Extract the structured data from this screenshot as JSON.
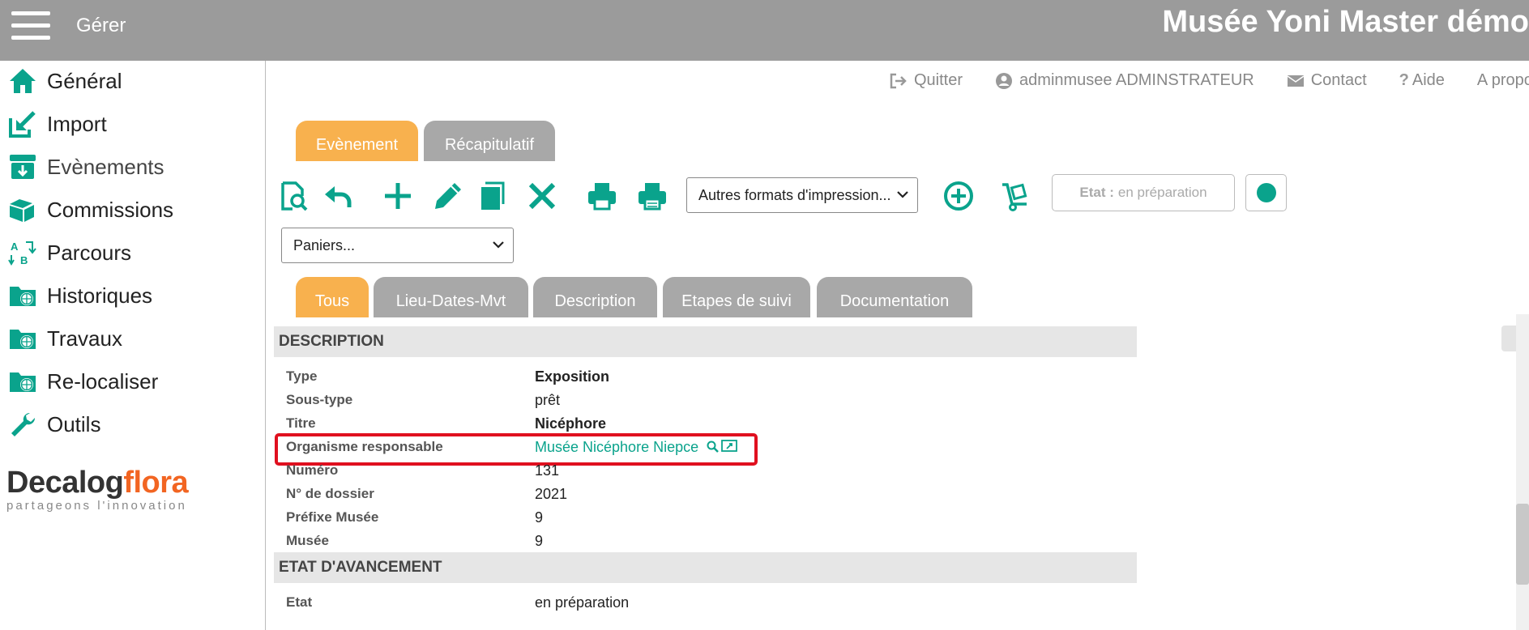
{
  "header": {
    "menu_label": "Gérer",
    "title": "Musée Yoni Master démo"
  },
  "sidebar": {
    "items": [
      {
        "label": "Général",
        "icon": "home-icon"
      },
      {
        "label": "Import",
        "icon": "import-icon"
      },
      {
        "label": "Evènements",
        "icon": "archive-box-icon"
      },
      {
        "label": "Commissions",
        "icon": "books-icon"
      },
      {
        "label": "Parcours",
        "icon": "sort-az-icon"
      },
      {
        "label": "Historiques",
        "icon": "folder-globe-icon"
      },
      {
        "label": "Travaux",
        "icon": "folder-globe-icon"
      },
      {
        "label": "Re-localiser",
        "icon": "folder-globe-icon"
      },
      {
        "label": "Outils",
        "icon": "wrench-icon"
      }
    ],
    "logo": {
      "brand_a": "Decalog",
      "brand_b": "flora",
      "tagline": "partageons l'innovation"
    }
  },
  "utility": {
    "quit": "Quitter",
    "user": "adminmusee ADMINSTRATEUR",
    "contact": "Contact",
    "help": "Aide",
    "about": "A propos"
  },
  "main_tabs": [
    "Evènement",
    "Récapitulatif"
  ],
  "toolbar": {
    "print_formats": "Autres formats d'impression...",
    "baskets": "Paniers...",
    "state_label": "Etat :",
    "state_value": "en préparation"
  },
  "sub_tabs": [
    "Tous",
    "Lieu-Dates-Mvt",
    "Description",
    "Etapes de suivi",
    "Documentation"
  ],
  "sections": {
    "description": {
      "title": "DESCRIPTION",
      "fields": [
        {
          "label": "Type",
          "value": "Exposition"
        },
        {
          "label": "Sous-type",
          "value": "prêt"
        },
        {
          "label": "Titre",
          "value": "Nicéphore"
        },
        {
          "label": "Organisme responsable",
          "value": "Musée Nicéphore Niepce"
        },
        {
          "label": "Numéro",
          "value": "131"
        },
        {
          "label": "N° de dossier",
          "value": "2021"
        },
        {
          "label": "Préfixe Musée",
          "value": "9"
        },
        {
          "label": "Musée",
          "value": "9"
        }
      ]
    },
    "progress": {
      "title": "ETAT D'AVANCEMENT",
      "fields": [
        {
          "label": "Etat",
          "value": "en préparation"
        }
      ]
    }
  },
  "colors": {
    "accent": "#0aa38c",
    "tab_active": "#f8b14e",
    "tab_inactive": "#a8a8a8",
    "topbar": "#9b9b9b",
    "highlight": "#e0101f"
  }
}
